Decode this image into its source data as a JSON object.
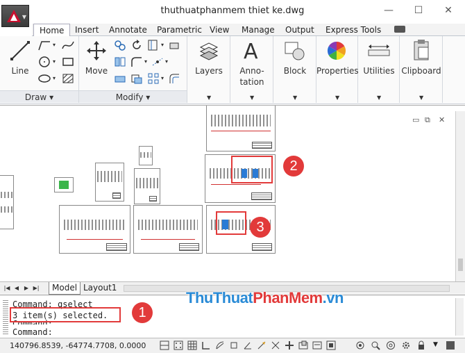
{
  "window": {
    "title": "thuthuatphanmem thiet ke.dwg",
    "controls": [
      "minimize",
      "maximize",
      "close"
    ]
  },
  "ribbon_tabs": [
    "Home",
    "Insert",
    "Annotate",
    "Parametric",
    "View",
    "Manage",
    "Output",
    "Express Tools"
  ],
  "active_tab": "Home",
  "panels": {
    "draw": {
      "title": "Draw",
      "line_label": "Line"
    },
    "modify": {
      "title": "Modify",
      "move_label": "Move"
    },
    "layers": {
      "label": "Layers"
    },
    "annotation": {
      "label_line1": "Anno-",
      "label_line2": "tation"
    },
    "block": {
      "label": "Block"
    },
    "properties": {
      "label": "Properties"
    },
    "utilities": {
      "label": "Utilities"
    },
    "clipboard": {
      "label": "Clipboard"
    }
  },
  "callouts": [
    "1",
    "2",
    "3"
  ],
  "layout_tabs": [
    "Model",
    "Layout1"
  ],
  "command_lines": [
    "Command: qselect",
    "3 item(s) selected.",
    "Command:",
    "Command:"
  ],
  "status": {
    "coordinates": "140796.8539, -64774.7708, 0.0000"
  },
  "watermark": {
    "part1": "ThuThuat",
    "part2": "PhanMem",
    "part3": ".vn"
  },
  "colors": {
    "highlight": "#e23a3a",
    "watermark_blue": "#2a8bd6",
    "app_red": "#c8102e"
  }
}
